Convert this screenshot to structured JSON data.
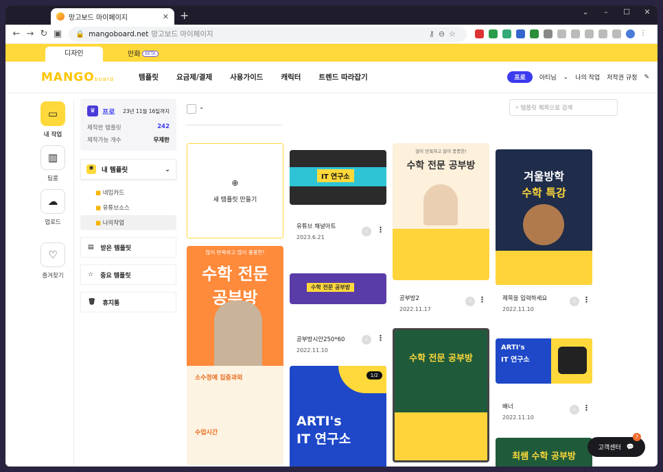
{
  "browser": {
    "tab_title": "망고보드 마이페이지",
    "new_tab": "+",
    "url": "mangoboard.net",
    "page_title": "망고보드 마이페이지",
    "window_controls": [
      "⌄",
      "–",
      "☐",
      "✕"
    ]
  },
  "ytabs": {
    "design": "디자인",
    "comic": "만화",
    "beta": "BETA"
  },
  "header": {
    "logo": "MANGO",
    "logo_sub": "board",
    "menu": [
      "템플릿",
      "요금제/결제",
      "사용가이드",
      "캐릭터",
      "트렌드 따라잡기"
    ],
    "pro": "프로",
    "user": "아티님",
    "my_work": "나의 작업",
    "copyright": "저작권 규정"
  },
  "left_nav": [
    {
      "label": "내 작업",
      "icon": "folder-icon"
    },
    {
      "label": "팀룸",
      "icon": "team-icon"
    },
    {
      "label": "업로드",
      "icon": "upload-icon"
    },
    {
      "label": "즐겨찾기",
      "icon": "heart-icon"
    }
  ],
  "sub": {
    "plan": "프로",
    "expire": "23년 11월 16일까지",
    "made_label": "제작한 템플릿",
    "made_value": "242",
    "avail_label": "제작가능 개수",
    "avail_value": "무제한",
    "my_templates": "내 템플릿",
    "folders": [
      "네임카드",
      "유튜브소스",
      "나의작업"
    ],
    "received": "받은 템플릿",
    "important": "중요 템플릿",
    "trash": "휴지통"
  },
  "main": {
    "search_placeholder": "템플릿 제목으로 검색",
    "new_template": "새 템플릿 만들기",
    "items": [
      {
        "name": "유튜브 채널아트",
        "date": "2023.6.21"
      },
      {
        "name": "공부방2",
        "date": "2022.11.17"
      },
      {
        "name": "제목을 입력하세요",
        "date": "2022.11.10"
      },
      {
        "name": "공부방시안250*60",
        "date": "2022.11.10"
      },
      {
        "name": "배너",
        "date": "2022.11.10"
      }
    ],
    "thumb_texts": {
      "math1": "수학 전문 공부방",
      "math1_sub": "많이 반복하고 많이 풍풍한!",
      "math2": "수학 전문",
      "math2b": "공부방",
      "winter": "겨울방학",
      "winter2": "수학 특강",
      "arti": "ARTI's",
      "arti2": "IT 연구소",
      "page": "1/2",
      "it_banner": "IT 연구소",
      "study_banner": "수학 전문 공부방",
      "section1": "소수정예 집중과외",
      "section2": "수업시간",
      "math3": "수학 전문 공부방",
      "best": "최쌤 수학 공부방"
    }
  },
  "help": {
    "label": "고객센터",
    "count": "7"
  }
}
